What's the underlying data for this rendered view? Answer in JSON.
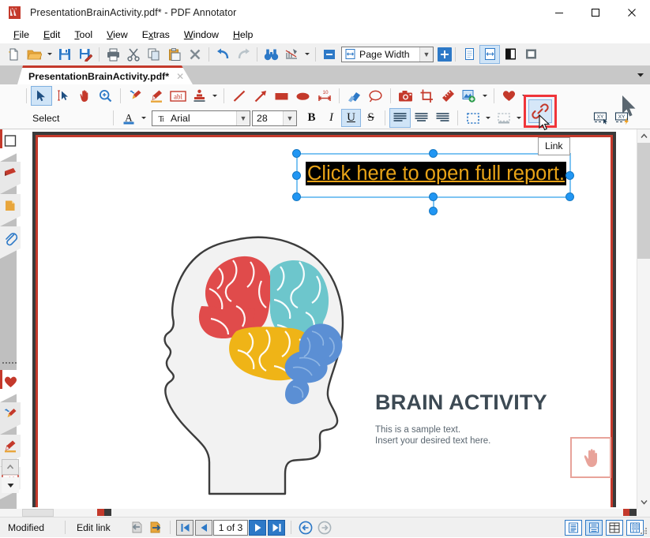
{
  "window": {
    "title": "PresentationBrainActivity.pdf* - PDF Annotator",
    "app_icon": "pdf-annotator-icon",
    "minimize": "minimize-icon",
    "maximize": "maximize-icon",
    "close": "close-icon"
  },
  "menu": {
    "items": [
      {
        "label": "File",
        "accel": "F"
      },
      {
        "label": "Edit",
        "accel": "E"
      },
      {
        "label": "Tool",
        "accel": "T"
      },
      {
        "label": "View",
        "accel": "V"
      },
      {
        "label": "Extras",
        "accel": "x"
      },
      {
        "label": "Window",
        "accel": "W"
      },
      {
        "label": "Help",
        "accel": "H"
      }
    ]
  },
  "main_toolbar": {
    "buttons": [
      {
        "name": "new-document-icon",
        "title": "New"
      },
      {
        "name": "open-folder-icon",
        "title": "Open"
      },
      {
        "name": "open-dropdown-icon",
        "title": "Open options"
      },
      {
        "name": "save-icon",
        "title": "Save"
      },
      {
        "name": "save-as-icon",
        "title": "Save As"
      },
      {
        "name": "print-icon",
        "title": "Print"
      },
      {
        "name": "cut-scissors-icon",
        "title": "Cut"
      },
      {
        "name": "copy-icon",
        "title": "Copy"
      },
      {
        "name": "paste-icon",
        "title": "Paste"
      },
      {
        "name": "delete-x-icon",
        "title": "Delete"
      },
      {
        "name": "undo-icon",
        "title": "Undo"
      },
      {
        "name": "redo-icon",
        "title": "Redo"
      },
      {
        "name": "find-binoculars-icon",
        "title": "Find"
      },
      {
        "name": "page-tools-icon",
        "title": "Page tools"
      },
      {
        "name": "page-tools-dropdown-icon",
        "title": "Page tools options"
      },
      {
        "name": "zoom-out-icon",
        "title": "Zoom out"
      }
    ],
    "zoom": {
      "value": "Page Width",
      "icon": "page-width-icon",
      "dropdown": "chevron-down-icon",
      "zoom_in": "zoom-in-plus-button"
    },
    "view_modes": [
      {
        "name": "single-page-view-icon",
        "active": false
      },
      {
        "name": "page-width-view-icon",
        "active": true
      },
      {
        "name": "facing-pages-view-icon",
        "active": false
      },
      {
        "name": "full-page-view-icon",
        "active": false
      }
    ]
  },
  "document_tab": {
    "label": "PresentationBrainActivity.pdf*",
    "close": "close-tab-icon",
    "list_dropdown": "tab-list-dropdown-icon"
  },
  "annotation_toolbar": {
    "tools": [
      {
        "name": "select-arrow-icon",
        "active": true
      },
      {
        "name": "text-select-icon",
        "active": false
      },
      {
        "name": "pan-hand-icon",
        "active": false
      },
      {
        "name": "zoom-magnifier-icon",
        "active": false
      },
      {
        "name": "pen-icon",
        "active": false
      },
      {
        "name": "highlighter-icon",
        "active": false
      },
      {
        "name": "text-box-icon",
        "active": false
      },
      {
        "name": "stamp-icon",
        "active": false
      },
      {
        "name": "stamp-dropdown-icon",
        "active": false
      },
      {
        "name": "line-icon",
        "active": false
      },
      {
        "name": "arrow-icon",
        "active": false
      },
      {
        "name": "rectangle-icon",
        "active": false
      },
      {
        "name": "ellipse-icon",
        "active": false
      },
      {
        "name": "measure-icon",
        "active": false
      },
      {
        "name": "eraser-icon",
        "active": false
      },
      {
        "name": "lasso-icon",
        "active": false
      },
      {
        "name": "snapshot-camera-icon",
        "active": false
      },
      {
        "name": "crop-icon",
        "active": false
      },
      {
        "name": "ruler-icon",
        "active": false
      },
      {
        "name": "insert-image-icon",
        "active": false
      },
      {
        "name": "insert-image-dropdown-icon",
        "active": false
      },
      {
        "name": "favorite-heart-icon",
        "active": false
      },
      {
        "name": "favorite-dropdown-icon",
        "active": false
      }
    ]
  },
  "format_toolbar": {
    "mode_label": "Select",
    "font_color_icon": "font-color-icon",
    "font_color_dropdown": "chevron-down-icon",
    "font": {
      "value": "Arial",
      "icon": "font-icon",
      "dropdown": "chevron-down-icon"
    },
    "size": {
      "value": "28",
      "dropdown": "chevron-down-icon"
    },
    "bold": {
      "label": "B",
      "active": false
    },
    "italic": {
      "label": "I",
      "active": false
    },
    "underline": {
      "label": "U",
      "active": true
    },
    "strikethrough": {
      "label": "S",
      "active": false
    },
    "align_left": {
      "name": "align-left-icon",
      "active": true
    },
    "align_center": {
      "name": "align-center-icon",
      "active": false
    },
    "align_right": {
      "name": "align-right-icon",
      "active": false
    },
    "border_style": {
      "name": "border-style-icon",
      "dropdown": "chevron-down-icon"
    },
    "shadow_style": {
      "name": "shadow-style-icon",
      "dropdown": "chevron-down-icon"
    },
    "fill_color": {
      "name": "fill-color-bucket-icon",
      "dropdown": "chevron-down-icon"
    },
    "link_button": {
      "name": "link-chain-icon",
      "label": "Link",
      "highlighted": true,
      "highlight_color": "#f0353a"
    },
    "xy_tool_1": {
      "name": "coordinates-select-icon"
    },
    "xy_tool_2": {
      "name": "coordinates-flash-icon"
    },
    "pointer": {
      "name": "mouse-cursor-icon"
    }
  },
  "tooltip": {
    "text": "Link"
  },
  "left_sidebar": {
    "items": [
      {
        "name": "page-thumbnail-icon",
        "active": true
      },
      {
        "name": "bookmark-ribbon-icon",
        "active": false
      },
      {
        "name": "notes-page-icon",
        "active": false
      },
      {
        "name": "attachments-paperclip-icon",
        "active": false
      },
      {
        "name": "favorites-heart-icon",
        "active": true
      },
      {
        "name": "pen-tool-icon",
        "active": false
      },
      {
        "name": "highlighter-tool-icon",
        "active": false
      },
      {
        "name": "text-box-tool-icon",
        "active": false
      }
    ],
    "scroll_up": "scroll-up-icon",
    "scroll_down": "scroll-down-icon",
    "grip": "drag-grip-icon"
  },
  "page": {
    "link_object": {
      "text": "Click here to open full report.",
      "text_color": "#e8a317",
      "background": "#000000",
      "selected": true
    },
    "slide": {
      "title": "BRAIN ACTIVITY",
      "body_line_1": "This is a sample text.",
      "body_line_2": "Insert your desired text here.",
      "graphic": "brain-head-illustration",
      "stamp": "hand-tap-stamp-icon",
      "brain_colors": {
        "frontal": "#e04b4b",
        "parietal": "#6dc6cc",
        "temporal": "#efb417",
        "cerebellum": "#5b8fd4",
        "head": "#f2f2f2"
      }
    }
  },
  "status_bar": {
    "modified": "Modified",
    "action": "Edit link",
    "nav": {
      "prev_view": "previous-view-icon",
      "next_view": "next-view-icon",
      "first_page": "first-page-icon",
      "prev_page": "previous-page-icon",
      "page_indicator": "1 of 3",
      "next_page": "next-page-icon",
      "last_page": "last-page-icon",
      "back": "back-circle-icon",
      "forward": "forward-circle-icon"
    },
    "view_modes": [
      {
        "name": "continuous-view-icon",
        "active": false
      },
      {
        "name": "single-page-layout-icon",
        "active": true
      },
      {
        "name": "two-column-view-icon",
        "active": false
      },
      {
        "name": "grid-view-icon",
        "active": false
      }
    ],
    "resize_grip": "resize-grip-icon"
  },
  "scrollbar": {
    "up": "scroll-up-arrow-icon",
    "down": "scroll-down-arrow-icon",
    "thumb": "vertical-scroll-thumb"
  }
}
